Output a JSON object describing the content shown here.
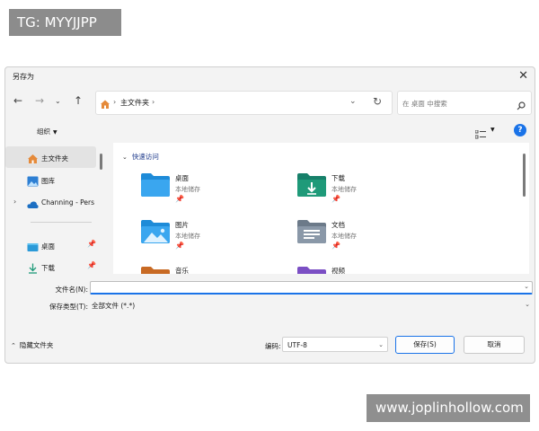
{
  "watermarks": {
    "top": "TG: MYYJJPP",
    "bottom": "www.joplinhollow.com"
  },
  "dialog": {
    "title": "另存为",
    "close_icon": "close-icon",
    "address": {
      "crumb": "主文件夹",
      "sep": "›"
    },
    "search": {
      "placeholder": "在 桌面 中搜索"
    },
    "toolbar": {
      "organize": "组织"
    },
    "sidebar": {
      "items": [
        {
          "label": "主文件夹",
          "icon": "home-icon"
        },
        {
          "label": "图库",
          "icon": "gallery-icon"
        },
        {
          "label": "Channing - Pers",
          "icon": "cloud-icon"
        },
        {
          "label": "桌面",
          "icon": "desktop-folder-icon"
        },
        {
          "label": "下载",
          "icon": "download-icon"
        }
      ]
    },
    "quick_access": {
      "header": "快速访问",
      "tiles": [
        {
          "name": "桌面",
          "sub": "本地储存"
        },
        {
          "name": "下载",
          "sub": "本地储存"
        },
        {
          "name": "图片",
          "sub": "本地储存"
        },
        {
          "name": "文档",
          "sub": "本地储存"
        },
        {
          "name": "音乐"
        },
        {
          "name": "视频"
        }
      ]
    },
    "fields": {
      "filename_label": "文件名(N):",
      "filename_value": "",
      "filetype_label": "保存类型(T):",
      "filetype_value": "全部文件  (*.*)"
    },
    "footer": {
      "hide_folders": "隐藏文件夹",
      "encoding_label": "编码:",
      "encoding_value": "UTF-8",
      "save_button": "保存(S)",
      "cancel_button": "取消"
    },
    "colors": {
      "accent": "#1a73e8",
      "folder_blue": "#1e8bd8",
      "folder_green": "#1f9a79"
    }
  }
}
